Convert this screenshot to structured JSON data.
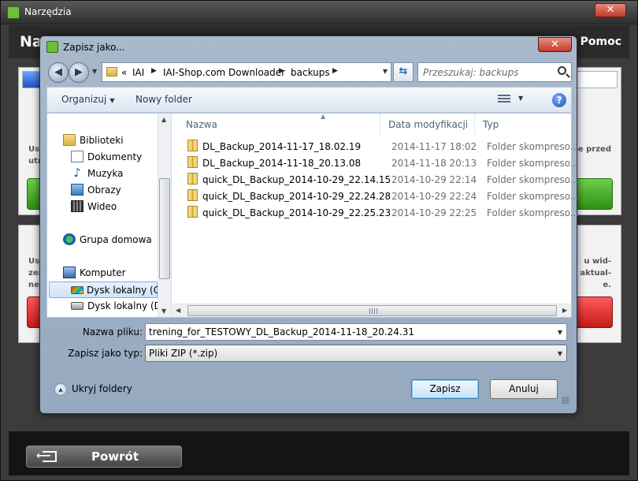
{
  "app": {
    "title": "Narzędzia",
    "close_label": "✕",
    "header_title": "Na",
    "help_label": "Pomoc",
    "panel1_left_text": [
      "Us",
      "utr"
    ],
    "panel1_right_text": [
      "ne przed"
    ],
    "panel2_left_text": [
      "Us",
      "zer",
      "nej"
    ],
    "panel2_right_text": [
      "u wid-",
      "aktual-",
      "e."
    ],
    "back_label": "Powrót"
  },
  "dialog": {
    "title": "Zapisz jako...",
    "close_label": "✕",
    "breadcrumb": {
      "prefix": "«",
      "items": [
        "IAI",
        "IAI-Shop.com Downloader",
        "backups"
      ]
    },
    "search_placeholder": "Przeszukaj: backups",
    "toolbar": {
      "organize_label": "Organizuj",
      "new_folder_label": "Nowy folder"
    },
    "nav": {
      "items": [
        {
          "label": "Biblioteki",
          "icon": "libraries-icon"
        },
        {
          "label": "Dokumenty",
          "icon": "documents-icon"
        },
        {
          "label": "Muzyka",
          "icon": "music-icon"
        },
        {
          "label": "Obrazy",
          "icon": "pictures-icon"
        },
        {
          "label": "Wideo",
          "icon": "video-icon"
        },
        {
          "label": "Grupa domowa",
          "icon": "homegroup-icon"
        },
        {
          "label": "Komputer",
          "icon": "computer-icon"
        },
        {
          "label": "Dysk lokalny (C:)",
          "icon": "local-disk-c-icon"
        },
        {
          "label": "Dysk lokalny (D:)",
          "icon": "local-disk-d-icon"
        }
      ]
    },
    "columns": {
      "name": "Nazwa",
      "date": "Data modyfikacji",
      "type": "Typ"
    },
    "files": [
      {
        "name": "DL_Backup_2014-11-17_18.02.19",
        "date": "2014-11-17 18:02",
        "type": "Folder skompreso..."
      },
      {
        "name": "DL_Backup_2014-11-18_20.13.08",
        "date": "2014-11-18 20:13",
        "type": "Folder skompreso..."
      },
      {
        "name": "quick_DL_Backup_2014-10-29_22.14.15",
        "date": "2014-10-29 22:14",
        "type": "Folder skompreso..."
      },
      {
        "name": "quick_DL_Backup_2014-10-29_22.24.28",
        "date": "2014-10-29 22:24",
        "type": "Folder skompreso..."
      },
      {
        "name": "quick_DL_Backup_2014-10-29_22.25.23",
        "date": "2014-10-29 22:25",
        "type": "Folder skompreso..."
      }
    ],
    "filename_label": "Nazwa pliku:",
    "filename_value": "trening_for_TESTOWY_DL_Backup_2014-11-18_20.24.31",
    "filetype_label": "Zapisz jako typ:",
    "filetype_value": "Pliki ZIP (*.zip)",
    "hide_folders_label": "Ukryj foldery",
    "save_label": "Zapisz",
    "cancel_label": "Anuluj"
  }
}
